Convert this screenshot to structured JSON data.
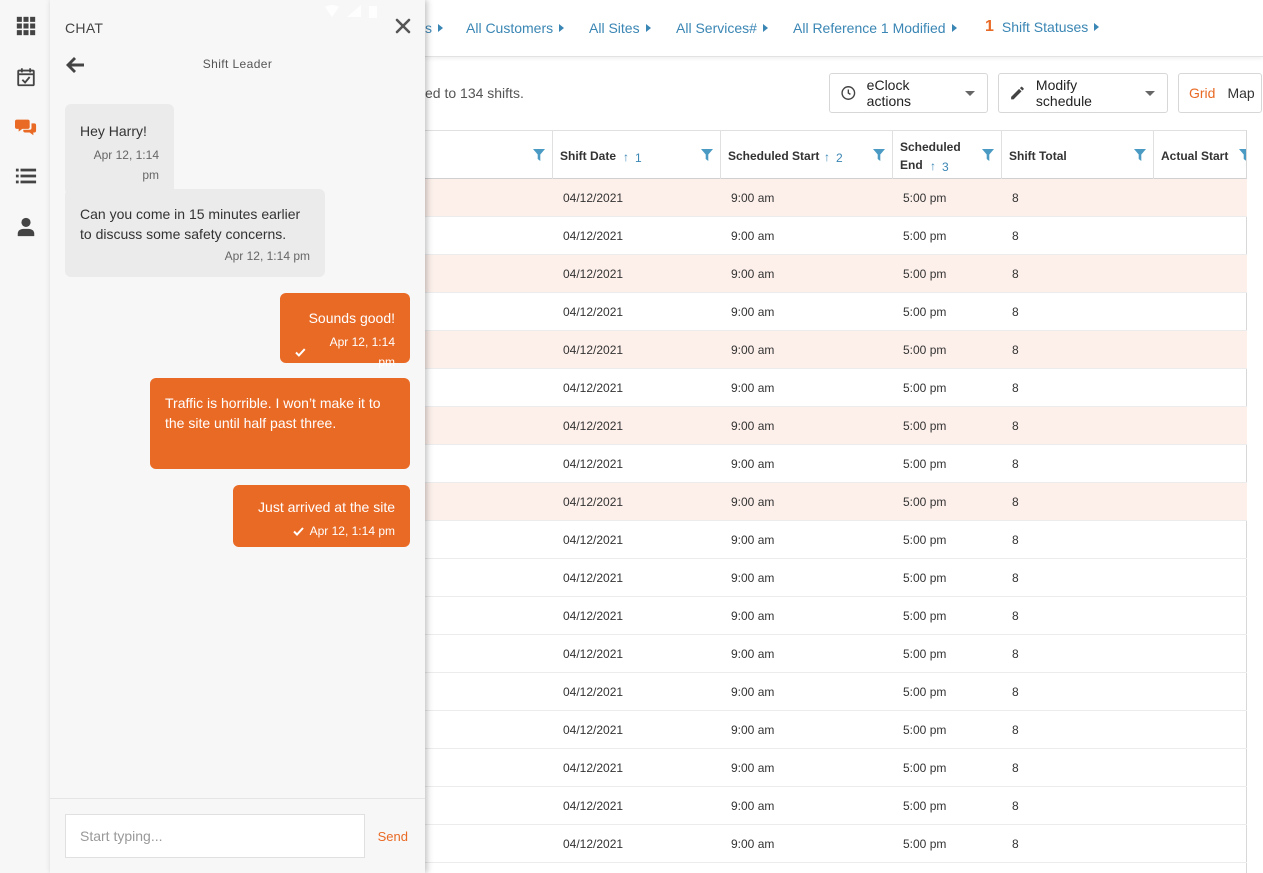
{
  "nav": {
    "breadcrumbs": [
      {
        "label": "s"
      },
      {
        "label": "All Customers"
      },
      {
        "label": "All Sites"
      },
      {
        "label": "All Services#"
      },
      {
        "label": "All Reference 1 Modified"
      },
      {
        "count": "1",
        "label": "Shift Statuses"
      }
    ]
  },
  "toolbar": {
    "subtitle": "ed to 134 shifts.",
    "eclock_label": "eClock actions",
    "modify_label": "Modify schedule",
    "view_grid": "Grid",
    "view_map": "Map"
  },
  "grid": {
    "columns": [
      {
        "label": "",
        "sort": ""
      },
      {
        "label": "Shift Date",
        "sort": "1"
      },
      {
        "label": "Scheduled Start",
        "sort": "2"
      },
      {
        "label": "Scheduled",
        "label2": "End",
        "sort": "3"
      },
      {
        "label": "Shift Total",
        "sort": ""
      },
      {
        "label": "Actual Start",
        "sort": ""
      }
    ],
    "rows": [
      {
        "date": "04/12/2021",
        "start": "9:00 am",
        "end": "5:00 pm",
        "total": "8"
      },
      {
        "date": "04/12/2021",
        "start": "9:00 am",
        "end": "5:00 pm",
        "total": "8"
      },
      {
        "date": "04/12/2021",
        "start": "9:00 am",
        "end": "5:00 pm",
        "total": "8"
      },
      {
        "date": "04/12/2021",
        "start": "9:00 am",
        "end": "5:00 pm",
        "total": "8"
      },
      {
        "date": "04/12/2021",
        "start": "9:00 am",
        "end": "5:00 pm",
        "total": "8"
      },
      {
        "date": "04/12/2021",
        "start": "9:00 am",
        "end": "5:00 pm",
        "total": "8"
      },
      {
        "date": "04/12/2021",
        "start": "9:00 am",
        "end": "5:00 pm",
        "total": "8"
      },
      {
        "date": "04/12/2021",
        "start": "9:00 am",
        "end": "5:00 pm",
        "total": "8"
      },
      {
        "date": "04/12/2021",
        "start": "9:00 am",
        "end": "5:00 pm",
        "total": "8"
      },
      {
        "date": "04/12/2021",
        "start": "9:00 am",
        "end": "5:00 pm",
        "total": "8"
      },
      {
        "date": "04/12/2021",
        "start": "9:00 am",
        "end": "5:00 pm",
        "total": "8"
      },
      {
        "date": "04/12/2021",
        "start": "9:00 am",
        "end": "5:00 pm",
        "total": "8"
      },
      {
        "date": "04/12/2021",
        "start": "9:00 am",
        "end": "5:00 pm",
        "total": "8"
      },
      {
        "date": "04/12/2021",
        "start": "9:00 am",
        "end": "5:00 pm",
        "total": "8"
      },
      {
        "date": "04/12/2021",
        "start": "9:00 am",
        "end": "5:00 pm",
        "total": "8"
      },
      {
        "date": "04/12/2021",
        "start": "9:00 am",
        "end": "5:00 pm",
        "total": "8"
      },
      {
        "date": "04/12/2021",
        "start": "9:00 am",
        "end": "5:00 pm",
        "total": "8"
      },
      {
        "date": "04/12/2021",
        "start": "9:00 am",
        "end": "5:00 pm",
        "total": "8"
      }
    ]
  },
  "chat": {
    "title": "CHAT",
    "subtitle": "Shift Leader",
    "messages": [
      {
        "dir": "in",
        "text": "Hey Harry!",
        "time": "Apr 12, 1:14 pm"
      },
      {
        "dir": "in",
        "text": "Can you come in 15 minutes earlier to discuss some safety concerns.",
        "time": "Apr 12, 1:14 pm"
      },
      {
        "dir": "out",
        "text": "Sounds good!",
        "time": "Apr 12, 1:14 pm"
      },
      {
        "dir": "out",
        "text": "Traffic is horrible. I won’t make it to the site until half past three.",
        "time": ""
      },
      {
        "dir": "out",
        "text": "Just arrived at the site",
        "time": "Apr 12, 1:14 pm"
      }
    ],
    "input_placeholder": "Start typing...",
    "send_label": "Send"
  },
  "sidebar": {
    "icons": [
      "apps-icon",
      "calendar-check-icon",
      "chat-icon",
      "list-icon",
      "user-icon"
    ]
  },
  "colors": {
    "accent": "#e96a25",
    "link": "#3a86b4",
    "row_highlight": "#fdf0eb"
  }
}
